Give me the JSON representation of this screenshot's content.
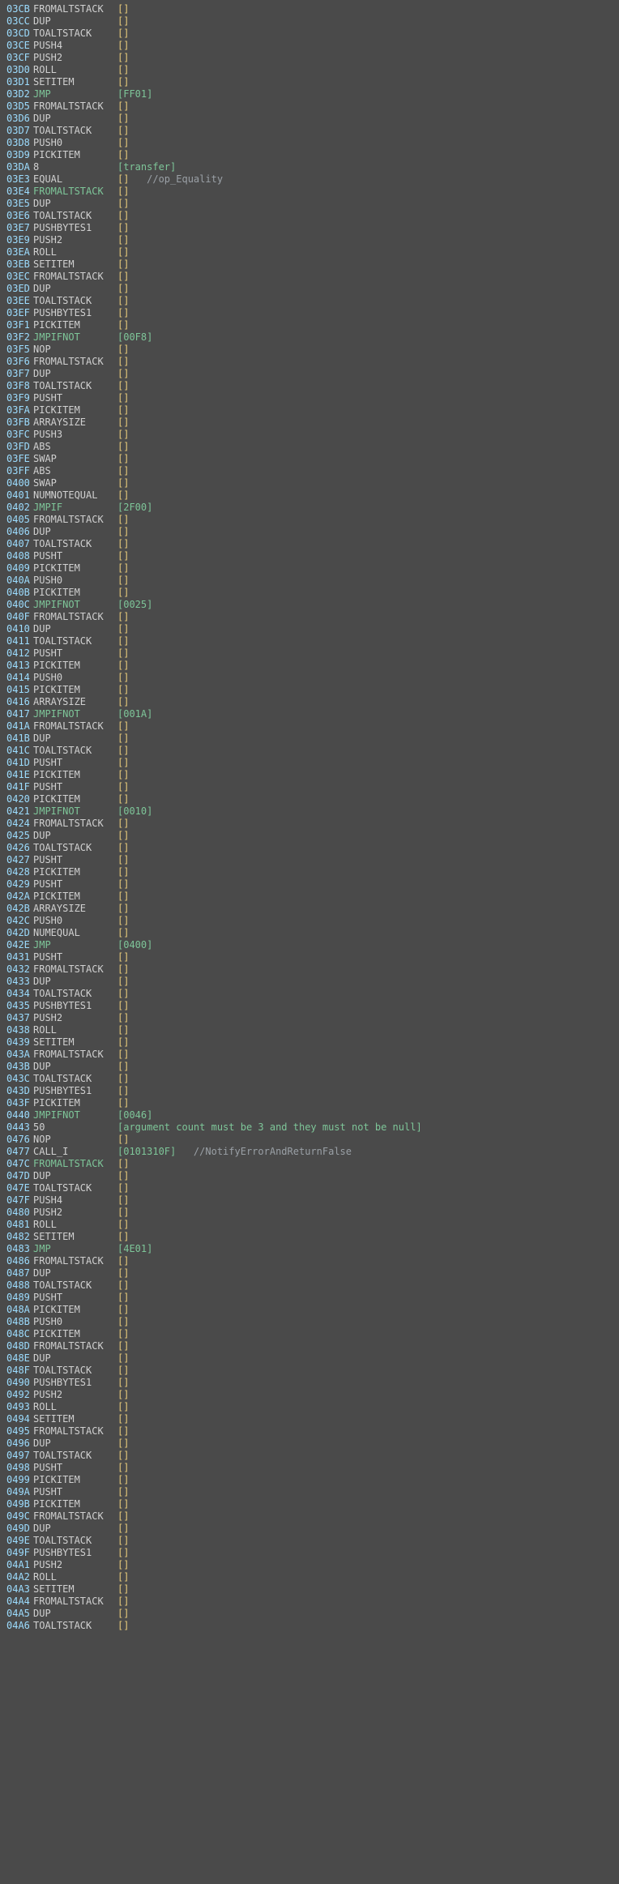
{
  "rows": [
    {
      "addr": "03CB",
      "op": "FROMALTSTACK",
      "opcls": "op-norm",
      "arg": "[]",
      "argcls": "arg-empty",
      "cmt": ""
    },
    {
      "addr": "03CC",
      "op": "DUP",
      "opcls": "op-norm",
      "arg": "[]",
      "argcls": "arg-empty",
      "cmt": ""
    },
    {
      "addr": "03CD",
      "op": "TOALTSTACK",
      "opcls": "op-norm",
      "arg": "[]",
      "argcls": "arg-empty",
      "cmt": ""
    },
    {
      "addr": "03CE",
      "op": "PUSH4",
      "opcls": "op-norm",
      "arg": "[]",
      "argcls": "arg-empty",
      "cmt": ""
    },
    {
      "addr": "03CF",
      "op": "PUSH2",
      "opcls": "op-norm",
      "arg": "[]",
      "argcls": "arg-empty",
      "cmt": ""
    },
    {
      "addr": "03D0",
      "op": "ROLL",
      "opcls": "op-norm",
      "arg": "[]",
      "argcls": "arg-empty",
      "cmt": ""
    },
    {
      "addr": "03D1",
      "op": "SETITEM",
      "opcls": "op-norm",
      "arg": "[]",
      "argcls": "arg-empty",
      "cmt": ""
    },
    {
      "addr": "03D2",
      "op": "JMP",
      "opcls": "op-jump",
      "arg": "[FF01]",
      "argcls": "arg-hex",
      "cmt": ""
    },
    {
      "addr": "03D5",
      "op": "FROMALTSTACK",
      "opcls": "op-norm",
      "arg": "[]",
      "argcls": "arg-empty",
      "cmt": ""
    },
    {
      "addr": "03D6",
      "op": "DUP",
      "opcls": "op-norm",
      "arg": "[]",
      "argcls": "arg-empty",
      "cmt": ""
    },
    {
      "addr": "03D7",
      "op": "TOALTSTACK",
      "opcls": "op-norm",
      "arg": "[]",
      "argcls": "arg-empty",
      "cmt": ""
    },
    {
      "addr": "03D8",
      "op": "PUSH0",
      "opcls": "op-norm",
      "arg": "[]",
      "argcls": "arg-empty",
      "cmt": ""
    },
    {
      "addr": "03D9",
      "op": "PICKITEM",
      "opcls": "op-norm",
      "arg": "[]",
      "argcls": "arg-empty",
      "cmt": ""
    },
    {
      "addr": "03DA",
      "op": "8",
      "opcls": "op-norm",
      "arg": "[transfer]",
      "argcls": "arg-str",
      "cmt": ""
    },
    {
      "addr": "03E3",
      "op": "EQUAL",
      "opcls": "op-norm",
      "arg": "[]",
      "argcls": "arg-empty",
      "cmt": "   //op_Equality"
    },
    {
      "addr": "03E4",
      "op": "FROMALTSTACK",
      "opcls": "op-green",
      "arg": "[]",
      "argcls": "arg-empty",
      "cmt": ""
    },
    {
      "addr": "03E5",
      "op": "DUP",
      "opcls": "op-norm",
      "arg": "[]",
      "argcls": "arg-empty",
      "cmt": ""
    },
    {
      "addr": "03E6",
      "op": "TOALTSTACK",
      "opcls": "op-norm",
      "arg": "[]",
      "argcls": "arg-empty",
      "cmt": ""
    },
    {
      "addr": "03E7",
      "op": "PUSHBYTES1",
      "opcls": "op-norm",
      "arg": "[]",
      "argcls": "arg-empty",
      "cmt": ""
    },
    {
      "addr": "03E9",
      "op": "PUSH2",
      "opcls": "op-norm",
      "arg": "[]",
      "argcls": "arg-empty",
      "cmt": ""
    },
    {
      "addr": "03EA",
      "op": "ROLL",
      "opcls": "op-norm",
      "arg": "[]",
      "argcls": "arg-empty",
      "cmt": ""
    },
    {
      "addr": "03EB",
      "op": "SETITEM",
      "opcls": "op-norm",
      "arg": "[]",
      "argcls": "arg-empty",
      "cmt": ""
    },
    {
      "addr": "03EC",
      "op": "FROMALTSTACK",
      "opcls": "op-norm",
      "arg": "[]",
      "argcls": "arg-empty",
      "cmt": ""
    },
    {
      "addr": "03ED",
      "op": "DUP",
      "opcls": "op-norm",
      "arg": "[]",
      "argcls": "arg-empty",
      "cmt": ""
    },
    {
      "addr": "03EE",
      "op": "TOALTSTACK",
      "opcls": "op-norm",
      "arg": "[]",
      "argcls": "arg-empty",
      "cmt": ""
    },
    {
      "addr": "03EF",
      "op": "PUSHBYTES1",
      "opcls": "op-norm",
      "arg": "[]",
      "argcls": "arg-empty",
      "cmt": ""
    },
    {
      "addr": "03F1",
      "op": "PICKITEM",
      "opcls": "op-norm",
      "arg": "[]",
      "argcls": "arg-empty",
      "cmt": ""
    },
    {
      "addr": "03F2",
      "op": "JMPIFNOT",
      "opcls": "op-jump",
      "arg": "[00F8]",
      "argcls": "arg-hex",
      "cmt": ""
    },
    {
      "addr": "03F5",
      "op": "NOP",
      "opcls": "op-norm",
      "arg": "[]",
      "argcls": "arg-empty",
      "cmt": ""
    },
    {
      "addr": "03F6",
      "op": "FROMALTSTACK",
      "opcls": "op-norm",
      "arg": "[]",
      "argcls": "arg-empty",
      "cmt": ""
    },
    {
      "addr": "03F7",
      "op": "DUP",
      "opcls": "op-norm",
      "arg": "[]",
      "argcls": "arg-empty",
      "cmt": ""
    },
    {
      "addr": "03F8",
      "op": "TOALTSTACK",
      "opcls": "op-norm",
      "arg": "[]",
      "argcls": "arg-empty",
      "cmt": ""
    },
    {
      "addr": "03F9",
      "op": "PUSHT",
      "opcls": "op-norm",
      "arg": "[]",
      "argcls": "arg-empty",
      "cmt": ""
    },
    {
      "addr": "03FA",
      "op": "PICKITEM",
      "opcls": "op-norm",
      "arg": "[]",
      "argcls": "arg-empty",
      "cmt": ""
    },
    {
      "addr": "03FB",
      "op": "ARRAYSIZE",
      "opcls": "op-norm",
      "arg": "[]",
      "argcls": "arg-empty",
      "cmt": ""
    },
    {
      "addr": "03FC",
      "op": "PUSH3",
      "opcls": "op-norm",
      "arg": "[]",
      "argcls": "arg-empty",
      "cmt": ""
    },
    {
      "addr": "03FD",
      "op": "ABS",
      "opcls": "op-norm",
      "arg": "[]",
      "argcls": "arg-empty",
      "cmt": ""
    },
    {
      "addr": "03FE",
      "op": "SWAP",
      "opcls": "op-norm",
      "arg": "[]",
      "argcls": "arg-empty",
      "cmt": ""
    },
    {
      "addr": "03FF",
      "op": "ABS",
      "opcls": "op-norm",
      "arg": "[]",
      "argcls": "arg-empty",
      "cmt": ""
    },
    {
      "addr": "0400",
      "op": "SWAP",
      "opcls": "op-norm",
      "arg": "[]",
      "argcls": "arg-empty",
      "cmt": ""
    },
    {
      "addr": "0401",
      "op": "NUMNOTEQUAL",
      "opcls": "op-norm",
      "arg": "[]",
      "argcls": "arg-empty",
      "cmt": ""
    },
    {
      "addr": "0402",
      "op": "JMPIF",
      "opcls": "op-jump",
      "arg": "[2F00]",
      "argcls": "arg-hex",
      "cmt": ""
    },
    {
      "addr": "0405",
      "op": "FROMALTSTACK",
      "opcls": "op-norm",
      "arg": "[]",
      "argcls": "arg-empty",
      "cmt": ""
    },
    {
      "addr": "0406",
      "op": "DUP",
      "opcls": "op-norm",
      "arg": "[]",
      "argcls": "arg-empty",
      "cmt": ""
    },
    {
      "addr": "0407",
      "op": "TOALTSTACK",
      "opcls": "op-norm",
      "arg": "[]",
      "argcls": "arg-empty",
      "cmt": ""
    },
    {
      "addr": "0408",
      "op": "PUSHT",
      "opcls": "op-norm",
      "arg": "[]",
      "argcls": "arg-empty",
      "cmt": ""
    },
    {
      "addr": "0409",
      "op": "PICKITEM",
      "opcls": "op-norm",
      "arg": "[]",
      "argcls": "arg-empty",
      "cmt": ""
    },
    {
      "addr": "040A",
      "op": "PUSH0",
      "opcls": "op-norm",
      "arg": "[]",
      "argcls": "arg-empty",
      "cmt": ""
    },
    {
      "addr": "040B",
      "op": "PICKITEM",
      "opcls": "op-norm",
      "arg": "[]",
      "argcls": "arg-empty",
      "cmt": ""
    },
    {
      "addr": "040C",
      "op": "JMPIFNOT",
      "opcls": "op-jump",
      "arg": "[0025]",
      "argcls": "arg-hex",
      "cmt": ""
    },
    {
      "addr": "040F",
      "op": "FROMALTSTACK",
      "opcls": "op-norm",
      "arg": "[]",
      "argcls": "arg-empty",
      "cmt": ""
    },
    {
      "addr": "0410",
      "op": "DUP",
      "opcls": "op-norm",
      "arg": "[]",
      "argcls": "arg-empty",
      "cmt": ""
    },
    {
      "addr": "0411",
      "op": "TOALTSTACK",
      "opcls": "op-norm",
      "arg": "[]",
      "argcls": "arg-empty",
      "cmt": ""
    },
    {
      "addr": "0412",
      "op": "PUSHT",
      "opcls": "op-norm",
      "arg": "[]",
      "argcls": "arg-empty",
      "cmt": ""
    },
    {
      "addr": "0413",
      "op": "PICKITEM",
      "opcls": "op-norm",
      "arg": "[]",
      "argcls": "arg-empty",
      "cmt": ""
    },
    {
      "addr": "0414",
      "op": "PUSH0",
      "opcls": "op-norm",
      "arg": "[]",
      "argcls": "arg-empty",
      "cmt": ""
    },
    {
      "addr": "0415",
      "op": "PICKITEM",
      "opcls": "op-norm",
      "arg": "[]",
      "argcls": "arg-empty",
      "cmt": ""
    },
    {
      "addr": "0416",
      "op": "ARRAYSIZE",
      "opcls": "op-norm",
      "arg": "[]",
      "argcls": "arg-empty",
      "cmt": ""
    },
    {
      "addr": "0417",
      "op": "JMPIFNOT",
      "opcls": "op-jump",
      "arg": "[001A]",
      "argcls": "arg-hex",
      "cmt": ""
    },
    {
      "addr": "041A",
      "op": "FROMALTSTACK",
      "opcls": "op-norm",
      "arg": "[]",
      "argcls": "arg-empty",
      "cmt": ""
    },
    {
      "addr": "041B",
      "op": "DUP",
      "opcls": "op-norm",
      "arg": "[]",
      "argcls": "arg-empty",
      "cmt": ""
    },
    {
      "addr": "041C",
      "op": "TOALTSTACK",
      "opcls": "op-norm",
      "arg": "[]",
      "argcls": "arg-empty",
      "cmt": ""
    },
    {
      "addr": "041D",
      "op": "PUSHT",
      "opcls": "op-norm",
      "arg": "[]",
      "argcls": "arg-empty",
      "cmt": ""
    },
    {
      "addr": "041E",
      "op": "PICKITEM",
      "opcls": "op-norm",
      "arg": "[]",
      "argcls": "arg-empty",
      "cmt": ""
    },
    {
      "addr": "041F",
      "op": "PUSHT",
      "opcls": "op-norm",
      "arg": "[]",
      "argcls": "arg-empty",
      "cmt": ""
    },
    {
      "addr": "0420",
      "op": "PICKITEM",
      "opcls": "op-norm",
      "arg": "[]",
      "argcls": "arg-empty",
      "cmt": ""
    },
    {
      "addr": "0421",
      "op": "JMPIFNOT",
      "opcls": "op-jump",
      "arg": "[0010]",
      "argcls": "arg-hex",
      "cmt": ""
    },
    {
      "addr": "0424",
      "op": "FROMALTSTACK",
      "opcls": "op-norm",
      "arg": "[]",
      "argcls": "arg-empty",
      "cmt": ""
    },
    {
      "addr": "0425",
      "op": "DUP",
      "opcls": "op-norm",
      "arg": "[]",
      "argcls": "arg-empty",
      "cmt": ""
    },
    {
      "addr": "0426",
      "op": "TOALTSTACK",
      "opcls": "op-norm",
      "arg": "[]",
      "argcls": "arg-empty",
      "cmt": ""
    },
    {
      "addr": "0427",
      "op": "PUSHT",
      "opcls": "op-norm",
      "arg": "[]",
      "argcls": "arg-empty",
      "cmt": ""
    },
    {
      "addr": "0428",
      "op": "PICKITEM",
      "opcls": "op-norm",
      "arg": "[]",
      "argcls": "arg-empty",
      "cmt": ""
    },
    {
      "addr": "0429",
      "op": "PUSHT",
      "opcls": "op-norm",
      "arg": "[]",
      "argcls": "arg-empty",
      "cmt": ""
    },
    {
      "addr": "042A",
      "op": "PICKITEM",
      "opcls": "op-norm",
      "arg": "[]",
      "argcls": "arg-empty",
      "cmt": ""
    },
    {
      "addr": "042B",
      "op": "ARRAYSIZE",
      "opcls": "op-norm",
      "arg": "[]",
      "argcls": "arg-empty",
      "cmt": ""
    },
    {
      "addr": "042C",
      "op": "PUSH0",
      "opcls": "op-norm",
      "arg": "[]",
      "argcls": "arg-empty",
      "cmt": ""
    },
    {
      "addr": "042D",
      "op": "NUMEQUAL",
      "opcls": "op-norm",
      "arg": "[]",
      "argcls": "arg-empty",
      "cmt": ""
    },
    {
      "addr": "042E",
      "op": "JMP",
      "opcls": "op-jump",
      "arg": "[0400]",
      "argcls": "arg-hex",
      "cmt": ""
    },
    {
      "addr": "0431",
      "op": "PUSHT",
      "opcls": "op-norm",
      "arg": "[]",
      "argcls": "arg-empty",
      "cmt": ""
    },
    {
      "addr": "0432",
      "op": "FROMALTSTACK",
      "opcls": "op-norm",
      "arg": "[]",
      "argcls": "arg-empty",
      "cmt": ""
    },
    {
      "addr": "0433",
      "op": "DUP",
      "opcls": "op-norm",
      "arg": "[]",
      "argcls": "arg-empty",
      "cmt": ""
    },
    {
      "addr": "0434",
      "op": "TOALTSTACK",
      "opcls": "op-norm",
      "arg": "[]",
      "argcls": "arg-empty",
      "cmt": ""
    },
    {
      "addr": "0435",
      "op": "PUSHBYTES1",
      "opcls": "op-norm",
      "arg": "[]",
      "argcls": "arg-empty",
      "cmt": ""
    },
    {
      "addr": "0437",
      "op": "PUSH2",
      "opcls": "op-norm",
      "arg": "[]",
      "argcls": "arg-empty",
      "cmt": ""
    },
    {
      "addr": "0438",
      "op": "ROLL",
      "opcls": "op-norm",
      "arg": "[]",
      "argcls": "arg-empty",
      "cmt": ""
    },
    {
      "addr": "0439",
      "op": "SETITEM",
      "opcls": "op-norm",
      "arg": "[]",
      "argcls": "arg-empty",
      "cmt": ""
    },
    {
      "addr": "043A",
      "op": "FROMALTSTACK",
      "opcls": "op-norm",
      "arg": "[]",
      "argcls": "arg-empty",
      "cmt": ""
    },
    {
      "addr": "043B",
      "op": "DUP",
      "opcls": "op-norm",
      "arg": "[]",
      "argcls": "arg-empty",
      "cmt": ""
    },
    {
      "addr": "043C",
      "op": "TOALTSTACK",
      "opcls": "op-norm",
      "arg": "[]",
      "argcls": "arg-empty",
      "cmt": ""
    },
    {
      "addr": "043D",
      "op": "PUSHBYTES1",
      "opcls": "op-norm",
      "arg": "[]",
      "argcls": "arg-empty",
      "cmt": ""
    },
    {
      "addr": "043F",
      "op": "PICKITEM",
      "opcls": "op-norm",
      "arg": "[]",
      "argcls": "arg-empty",
      "cmt": ""
    },
    {
      "addr": "0440",
      "op": "JMPIFNOT",
      "opcls": "op-jump",
      "arg": "[0046]",
      "argcls": "arg-hex",
      "cmt": ""
    },
    {
      "addr": "0443",
      "op": "50",
      "opcls": "op-norm",
      "arg": "[argument count must be 3 and they must not be null]",
      "argcls": "arg-str",
      "cmt": ""
    },
    {
      "addr": "0476",
      "op": "NOP",
      "opcls": "op-norm",
      "arg": "[]",
      "argcls": "arg-empty",
      "cmt": ""
    },
    {
      "addr": "0477",
      "op": "CALL_I",
      "opcls": "op-norm",
      "arg": "[0101310F]",
      "argcls": "arg-hex",
      "cmt": "   //NotifyErrorAndReturnFalse"
    },
    {
      "addr": "047C",
      "op": "FROMALTSTACK",
      "opcls": "op-green",
      "arg": "[]",
      "argcls": "arg-empty",
      "cmt": ""
    },
    {
      "addr": "047D",
      "op": "DUP",
      "opcls": "op-norm",
      "arg": "[]",
      "argcls": "arg-empty",
      "cmt": ""
    },
    {
      "addr": "047E",
      "op": "TOALTSTACK",
      "opcls": "op-norm",
      "arg": "[]",
      "argcls": "arg-empty",
      "cmt": ""
    },
    {
      "addr": "047F",
      "op": "PUSH4",
      "opcls": "op-norm",
      "arg": "[]",
      "argcls": "arg-empty",
      "cmt": ""
    },
    {
      "addr": "0480",
      "op": "PUSH2",
      "opcls": "op-norm",
      "arg": "[]",
      "argcls": "arg-empty",
      "cmt": ""
    },
    {
      "addr": "0481",
      "op": "ROLL",
      "opcls": "op-norm",
      "arg": "[]",
      "argcls": "arg-empty",
      "cmt": ""
    },
    {
      "addr": "0482",
      "op": "SETITEM",
      "opcls": "op-norm",
      "arg": "[]",
      "argcls": "arg-empty",
      "cmt": ""
    },
    {
      "addr": "0483",
      "op": "JMP",
      "opcls": "op-jump",
      "arg": "[4E01]",
      "argcls": "arg-hex",
      "cmt": ""
    },
    {
      "addr": "0486",
      "op": "FROMALTSTACK",
      "opcls": "op-norm",
      "arg": "[]",
      "argcls": "arg-empty",
      "cmt": ""
    },
    {
      "addr": "0487",
      "op": "DUP",
      "opcls": "op-norm",
      "arg": "[]",
      "argcls": "arg-empty",
      "cmt": ""
    },
    {
      "addr": "0488",
      "op": "TOALTSTACK",
      "opcls": "op-norm",
      "arg": "[]",
      "argcls": "arg-empty",
      "cmt": ""
    },
    {
      "addr": "0489",
      "op": "PUSHT",
      "opcls": "op-norm",
      "arg": "[]",
      "argcls": "arg-empty",
      "cmt": ""
    },
    {
      "addr": "048A",
      "op": "PICKITEM",
      "opcls": "op-norm",
      "arg": "[]",
      "argcls": "arg-empty",
      "cmt": ""
    },
    {
      "addr": "048B",
      "op": "PUSH0",
      "opcls": "op-norm",
      "arg": "[]",
      "argcls": "arg-empty",
      "cmt": ""
    },
    {
      "addr": "048C",
      "op": "PICKITEM",
      "opcls": "op-norm",
      "arg": "[]",
      "argcls": "arg-empty",
      "cmt": ""
    },
    {
      "addr": "048D",
      "op": "FROMALTSTACK",
      "opcls": "op-norm",
      "arg": "[]",
      "argcls": "arg-empty",
      "cmt": ""
    },
    {
      "addr": "048E",
      "op": "DUP",
      "opcls": "op-norm",
      "arg": "[]",
      "argcls": "arg-empty",
      "cmt": ""
    },
    {
      "addr": "048F",
      "op": "TOALTSTACK",
      "opcls": "op-norm",
      "arg": "[]",
      "argcls": "arg-empty",
      "cmt": ""
    },
    {
      "addr": "0490",
      "op": "PUSHBYTES1",
      "opcls": "op-norm",
      "arg": "[]",
      "argcls": "arg-empty",
      "cmt": ""
    },
    {
      "addr": "0492",
      "op": "PUSH2",
      "opcls": "op-norm",
      "arg": "[]",
      "argcls": "arg-empty",
      "cmt": ""
    },
    {
      "addr": "0493",
      "op": "ROLL",
      "opcls": "op-norm",
      "arg": "[]",
      "argcls": "arg-empty",
      "cmt": ""
    },
    {
      "addr": "0494",
      "op": "SETITEM",
      "opcls": "op-norm",
      "arg": "[]",
      "argcls": "arg-empty",
      "cmt": ""
    },
    {
      "addr": "0495",
      "op": "FROMALTSTACK",
      "opcls": "op-norm",
      "arg": "[]",
      "argcls": "arg-empty",
      "cmt": ""
    },
    {
      "addr": "0496",
      "op": "DUP",
      "opcls": "op-norm",
      "arg": "[]",
      "argcls": "arg-empty",
      "cmt": ""
    },
    {
      "addr": "0497",
      "op": "TOALTSTACK",
      "opcls": "op-norm",
      "arg": "[]",
      "argcls": "arg-empty",
      "cmt": ""
    },
    {
      "addr": "0498",
      "op": "PUSHT",
      "opcls": "op-norm",
      "arg": "[]",
      "argcls": "arg-empty",
      "cmt": ""
    },
    {
      "addr": "0499",
      "op": "PICKITEM",
      "opcls": "op-norm",
      "arg": "[]",
      "argcls": "arg-empty",
      "cmt": ""
    },
    {
      "addr": "049A",
      "op": "PUSHT",
      "opcls": "op-norm",
      "arg": "[]",
      "argcls": "arg-empty",
      "cmt": ""
    },
    {
      "addr": "049B",
      "op": "PICKITEM",
      "opcls": "op-norm",
      "arg": "[]",
      "argcls": "arg-empty",
      "cmt": ""
    },
    {
      "addr": "049C",
      "op": "FROMALTSTACK",
      "opcls": "op-norm",
      "arg": "[]",
      "argcls": "arg-empty",
      "cmt": ""
    },
    {
      "addr": "049D",
      "op": "DUP",
      "opcls": "op-norm",
      "arg": "[]",
      "argcls": "arg-empty",
      "cmt": ""
    },
    {
      "addr": "049E",
      "op": "TOALTSTACK",
      "opcls": "op-norm",
      "arg": "[]",
      "argcls": "arg-empty",
      "cmt": ""
    },
    {
      "addr": "049F",
      "op": "PUSHBYTES1",
      "opcls": "op-norm",
      "arg": "[]",
      "argcls": "arg-empty",
      "cmt": ""
    },
    {
      "addr": "04A1",
      "op": "PUSH2",
      "opcls": "op-norm",
      "arg": "[]",
      "argcls": "arg-empty",
      "cmt": ""
    },
    {
      "addr": "04A2",
      "op": "ROLL",
      "opcls": "op-norm",
      "arg": "[]",
      "argcls": "arg-empty",
      "cmt": ""
    },
    {
      "addr": "04A3",
      "op": "SETITEM",
      "opcls": "op-norm",
      "arg": "[]",
      "argcls": "arg-empty",
      "cmt": ""
    },
    {
      "addr": "04A4",
      "op": "FROMALTSTACK",
      "opcls": "op-norm",
      "arg": "[]",
      "argcls": "arg-empty",
      "cmt": ""
    },
    {
      "addr": "04A5",
      "op": "DUP",
      "opcls": "op-norm",
      "arg": "[]",
      "argcls": "arg-empty",
      "cmt": ""
    },
    {
      "addr": "04A6",
      "op": "TOALTSTACK",
      "opcls": "op-norm",
      "arg": "[]",
      "argcls": "arg-empty",
      "cmt": ""
    }
  ]
}
